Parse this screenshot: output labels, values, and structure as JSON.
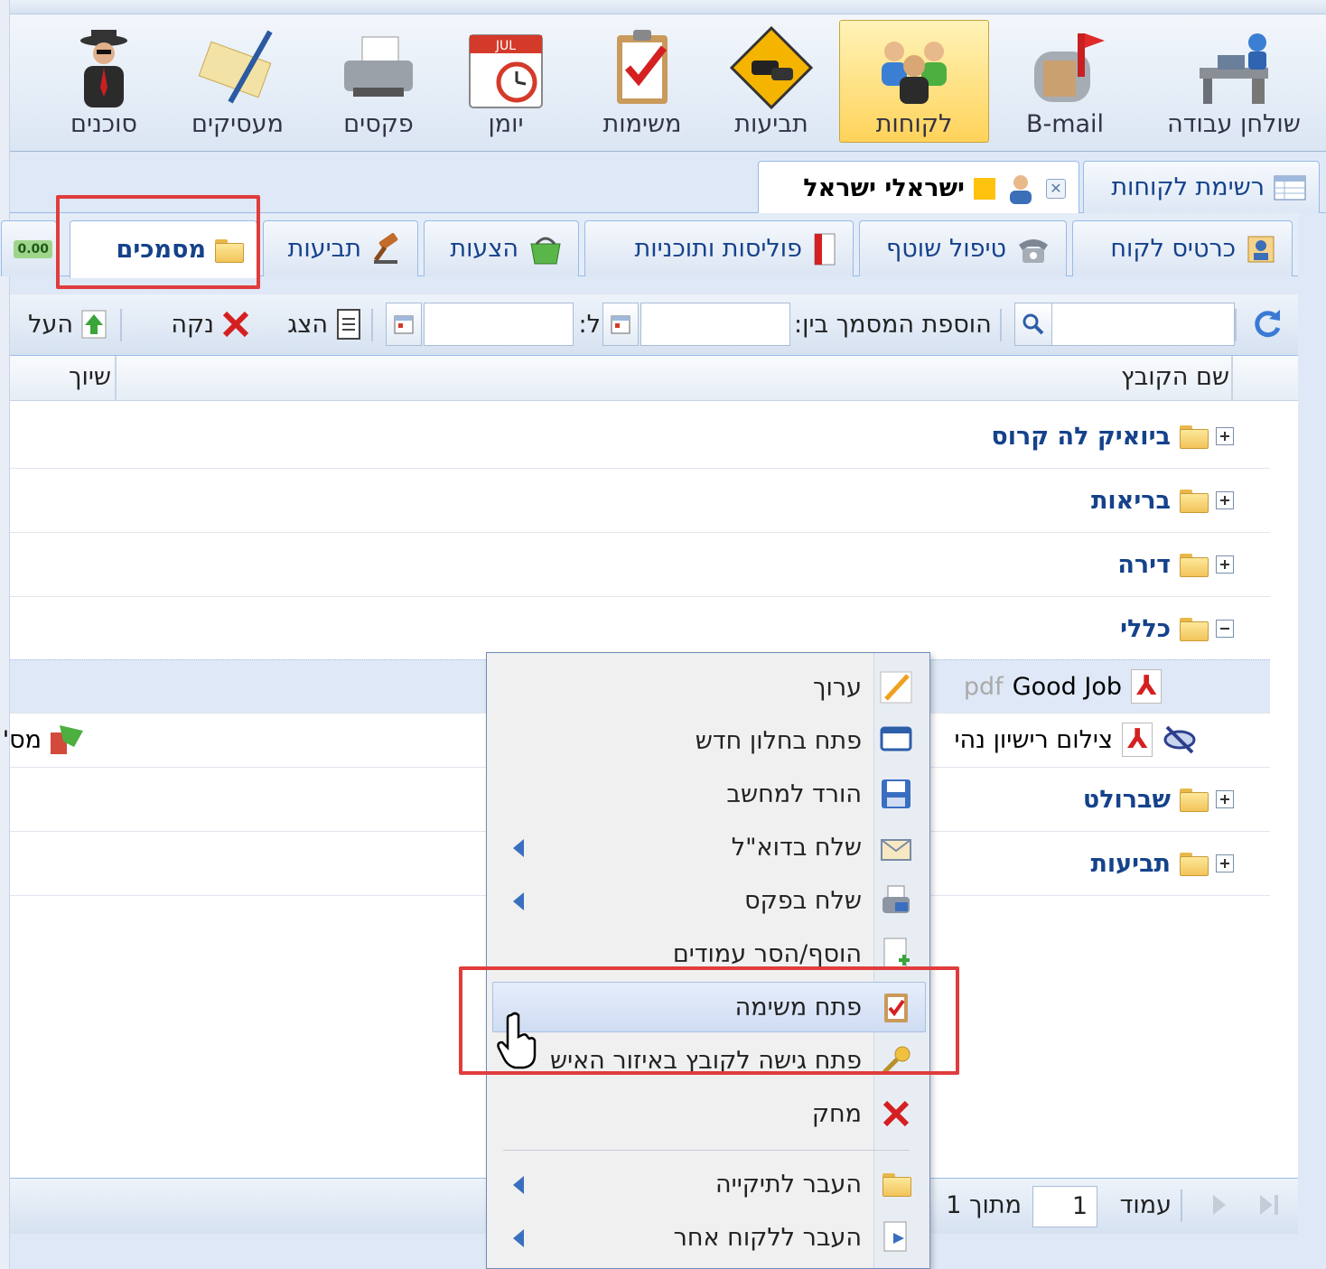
{
  "modules": [
    {
      "label": "שולחן עבודה",
      "icon": "desk-icon"
    },
    {
      "label": "B-mail",
      "icon": "mailbox-icon"
    },
    {
      "label": "לקוחות",
      "icon": "customers-icon",
      "active": true
    },
    {
      "label": "תביעות",
      "icon": "car-accident-icon"
    },
    {
      "label": "משימות",
      "icon": "clipboard-check-icon"
    },
    {
      "label": "יומן",
      "icon": "calendar-icon",
      "calendar_month": "JUL"
    },
    {
      "label": "פקסים",
      "icon": "fax-printer-icon"
    },
    {
      "label": "מעסיקים",
      "icon": "employers-pen-icon"
    },
    {
      "label": "סוכנים",
      "icon": "agent-spy-icon"
    }
  ],
  "record_tabs": [
    {
      "label": "רשימת לקוחות",
      "icon": "grid-icon"
    },
    {
      "label": "ישראלי ישראל",
      "icon": "user-icon",
      "active": true
    }
  ],
  "inner_tabs": [
    {
      "label": "כרטיס לקוח",
      "icon": "customer-card-icon"
    },
    {
      "label": "טיפול שוטף",
      "icon": "phone-icon"
    },
    {
      "label": "פוליסות ותוכניות",
      "icon": "policy-book-icon"
    },
    {
      "label": "הצעות",
      "icon": "basket-icon"
    },
    {
      "label": "תביעות",
      "icon": "gavel-icon"
    },
    {
      "label": "מסמכים",
      "icon": "folder-icon",
      "active": true
    },
    {
      "label": "0.00",
      "icon": "money-icon"
    }
  ],
  "filter_bar": {
    "added_between_label": "הוספת המסמך בין:",
    "to_label": "ל:",
    "show_label": "הצג",
    "clear_label": "נקה",
    "upload_label": "העל"
  },
  "grid": {
    "columns": [
      "שם הקובץ",
      "שיוך"
    ],
    "rows": [
      {
        "type": "folder",
        "name": "ביואיק לה קרוס",
        "expanded": false
      },
      {
        "type": "folder",
        "name": "בריאות",
        "expanded": false
      },
      {
        "type": "folder",
        "name": "דירה",
        "expanded": false
      },
      {
        "type": "folder",
        "name": "כללי",
        "expanded": true
      },
      {
        "type": "file",
        "name": "Good Job",
        "ext": "pdf",
        "selected": true
      },
      {
        "type": "file",
        "name": "צילום רישיון נהי",
        "assoc": "מס'"
      },
      {
        "type": "folder",
        "name": "שברולט",
        "expanded": false
      },
      {
        "type": "folder",
        "name": "תביעות",
        "expanded": false
      }
    ]
  },
  "paging": {
    "page_label": "עמוד",
    "page_value": "1",
    "of_label": "מתוך 1"
  },
  "context_menu": {
    "items": [
      {
        "label": "ערוך",
        "icon": "pencil-icon"
      },
      {
        "label": "פתח בחלון חדש",
        "icon": "new-window-icon"
      },
      {
        "label": "הורד למחשב",
        "icon": "save-disk-icon"
      },
      {
        "label": "שלח בדוא\"ל",
        "icon": "email-icon",
        "submenu": true
      },
      {
        "label": "שלח בפקס",
        "icon": "fax-icon",
        "submenu": true
      },
      {
        "label": "הוסף/הסר עמודים",
        "icon": "add-page-icon"
      },
      {
        "label": "פתח משימה",
        "icon": "task-icon",
        "hover": true
      },
      {
        "label": "פתח גישה לקובץ באיזור האיש",
        "icon": "key-icon"
      },
      {
        "label": "מחק",
        "icon": "delete-icon"
      },
      {
        "label": "העבר לתיקייה",
        "icon": "folder-move-icon",
        "submenu": true
      },
      {
        "label": "העבר ללקוח אחר",
        "icon": "move-to-customer-icon",
        "submenu": true
      }
    ]
  },
  "colors": {
    "highlight": "#e03c3c",
    "accent": "#15428b"
  }
}
